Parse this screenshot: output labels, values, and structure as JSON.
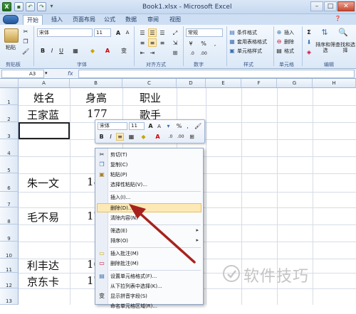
{
  "app": {
    "title": "Book1.xlsx - Microsoft Excel",
    "logo_letter": "X"
  },
  "quick_access": {
    "save_icon": "save-icon",
    "undo_icon": "undo-icon",
    "redo_icon": "redo-icon"
  },
  "tabs": [
    {
      "label": "开始",
      "active": true
    },
    {
      "label": "插入"
    },
    {
      "label": "页面布局"
    },
    {
      "label": "公式"
    },
    {
      "label": "数据"
    },
    {
      "label": "审阅"
    },
    {
      "label": "视图"
    }
  ],
  "ribbon": {
    "clipboard": {
      "paste_label": "粘贴",
      "group_label": "剪贴板"
    },
    "font": {
      "font_name": "宋体",
      "font_size": "11",
      "group_label": "字体",
      "bold": "B",
      "italic": "I",
      "underline": "U",
      "grow": "A",
      "shrink": "A",
      "font_color": "A",
      "phonetic": "变"
    },
    "alignment": {
      "group_label": "对齐方式"
    },
    "number": {
      "format": "常规",
      "group_label": "数字"
    },
    "styles": {
      "conditional": "条件格式",
      "table": "套用表格格式",
      "cell_styles": "单元格样式",
      "group_label": "样式"
    },
    "cells": {
      "insert": "插入",
      "delete": "删除",
      "format": "格式",
      "group_label": "单元格"
    },
    "editing": {
      "sigma": "Σ",
      "sort_filter": "排序和筛选",
      "find_select": "查找和选择",
      "group_label": "编辑"
    }
  },
  "formula_bar": {
    "name_box": "A3",
    "fx": "fx",
    "value": ""
  },
  "columns": [
    "A",
    "B",
    "C",
    "D",
    "E",
    "F",
    "G",
    "H"
  ],
  "rows": [
    "1",
    "2",
    "3",
    "4",
    "5",
    "6",
    "7",
    "8",
    "9",
    "10",
    "11",
    "12",
    "13"
  ],
  "cells": {
    "a1": "姓名",
    "b1": "身高",
    "c1": "职业",
    "a2": "王家蓝",
    "b2": "177",
    "c2": "歌手",
    "a6": "朱一文",
    "b6": "18",
    "a8": "毛不易",
    "b8": "17",
    "a12": "利丰达",
    "b12": "16",
    "a13": "京东卡",
    "b13": "17"
  },
  "mini_toolbar": {
    "font": "宋体",
    "size": "11",
    "bold": "B",
    "italic": "I",
    "grow": "A",
    "shrink": "A",
    "font_color": "A",
    "percent": "%"
  },
  "context_menu": [
    {
      "label": "剪切(T)",
      "icon": "cut-icon"
    },
    {
      "label": "复制(C)",
      "icon": "copy-icon"
    },
    {
      "label": "粘贴(P)",
      "icon": "paste-icon"
    },
    {
      "label": "选择性粘贴(V)..."
    },
    {
      "label": "插入(I)..."
    },
    {
      "label": "删除(D)...",
      "highlight": true
    },
    {
      "label": "清除内容(N)"
    },
    {
      "label": "筛选(E)",
      "submenu": true
    },
    {
      "label": "排序(O)",
      "submenu": true
    },
    {
      "label": "插入批注(M)",
      "icon": "comment-icon"
    },
    {
      "label": "删除批注(M)",
      "icon": "delete-comment-icon"
    },
    {
      "label": "设置单元格格式(F)...",
      "icon": "format-cells-icon"
    },
    {
      "label": "从下拉列表中选择(K)..."
    },
    {
      "label": "显示拼音字段(S)",
      "icon": "phonetic-icon"
    },
    {
      "label": "命名单元格区域(R)..."
    }
  ],
  "watermark": {
    "text": "软件技巧"
  },
  "colors": {
    "accent": "#1f6a1f",
    "arrow": "#a8221c",
    "highlight": "#fde9b5"
  }
}
